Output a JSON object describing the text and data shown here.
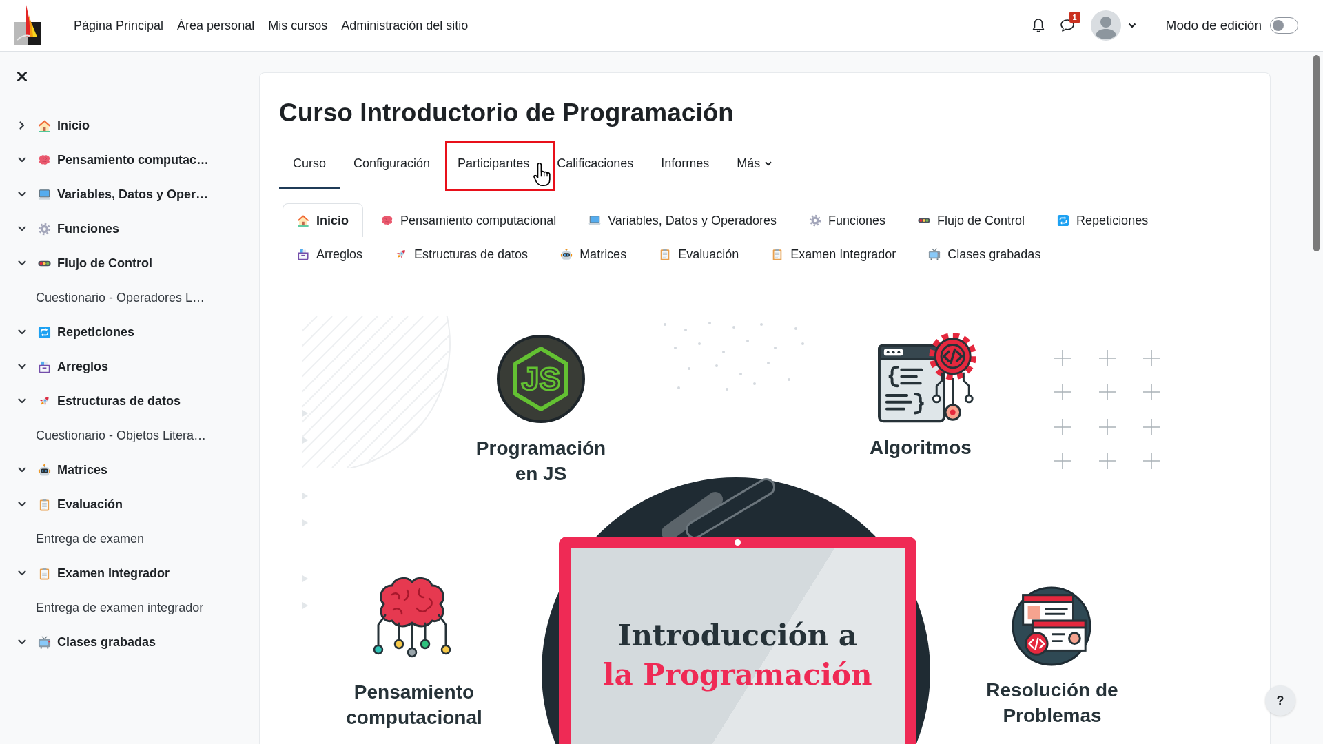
{
  "navbar": {
    "links": [
      {
        "label": "Página Principal"
      },
      {
        "label": "Área personal"
      },
      {
        "label": "Mis cursos"
      },
      {
        "label": "Administración del sitio"
      }
    ],
    "message_count": "1",
    "edit_mode": {
      "label": "Modo de edición",
      "on": false
    }
  },
  "sidebar": {
    "sections": [
      {
        "title": "Inicio",
        "expanded": false
      },
      {
        "title": "Pensamiento computac…",
        "expanded": true
      },
      {
        "title": "Variables, Datos y Oper…",
        "expanded": true
      },
      {
        "title": "Funciones",
        "expanded": true
      },
      {
        "title": "Flujo de Control",
        "expanded": true,
        "children": [
          {
            "title": "Cuestionario - Operadores L…"
          }
        ]
      },
      {
        "title": "Repeticiones",
        "expanded": true
      },
      {
        "title": "Arreglos",
        "expanded": true
      },
      {
        "title": "Estructuras de datos",
        "expanded": true,
        "children": [
          {
            "title": "Cuestionario - Objetos Litera…"
          }
        ]
      },
      {
        "title": "Matrices",
        "expanded": true
      },
      {
        "title": "Evaluación",
        "expanded": true,
        "children": [
          {
            "title": "Entrega de examen"
          }
        ]
      },
      {
        "title": "Examen Integrador",
        "expanded": true,
        "children": [
          {
            "title": "Entrega de examen integrador"
          }
        ]
      },
      {
        "title": "Clases grabadas",
        "expanded": true
      }
    ]
  },
  "course": {
    "title": "Curso Introductorio de Programación",
    "tabs": [
      {
        "label": "Curso",
        "kind": "link",
        "selected": true,
        "highlighted": false,
        "hovered": false
      },
      {
        "label": "Configuración",
        "kind": "link",
        "selected": false,
        "highlighted": false,
        "hovered": false
      },
      {
        "label": "Participantes",
        "kind": "link",
        "selected": false,
        "highlighted": true,
        "hovered": true
      },
      {
        "label": "Calificaciones",
        "kind": "link",
        "selected": false,
        "highlighted": false,
        "hovered": false
      },
      {
        "label": "Informes",
        "kind": "link",
        "selected": false,
        "highlighted": false,
        "hovered": false
      },
      {
        "label": "Más",
        "kind": "menu",
        "selected": false,
        "highlighted": false,
        "hovered": false
      }
    ],
    "section_tabs": [
      {
        "label": "Inicio",
        "selected": true
      },
      {
        "label": "Pensamiento computacional",
        "selected": false
      },
      {
        "label": "Variables, Datos y Operadores",
        "selected": false
      },
      {
        "label": "Funciones",
        "selected": false
      },
      {
        "label": "Flujo de Control",
        "selected": false
      },
      {
        "label": "Repeticiones",
        "selected": false
      },
      {
        "label": "Arreglos",
        "selected": false
      },
      {
        "label": "Estructuras de datos",
        "selected": false
      },
      {
        "label": "Matrices",
        "selected": false
      },
      {
        "label": "Evaluación",
        "selected": false
      },
      {
        "label": "Examen Integrador",
        "selected": false
      },
      {
        "label": "Clases grabadas",
        "selected": false
      }
    ],
    "banner": {
      "topics": [
        {
          "label": "Programación en JS",
          "logo_text": "JS"
        },
        {
          "label": "Algoritmos"
        },
        {
          "label": "Pensamiento computacional"
        },
        {
          "label": "Resolución de Problemas"
        }
      ],
      "headline": [
        {
          "text": "Introducción a",
          "accent": false
        },
        {
          "text": "la Programación",
          "accent": true
        }
      ]
    }
  },
  "help_button": {
    "label": "?"
  }
}
